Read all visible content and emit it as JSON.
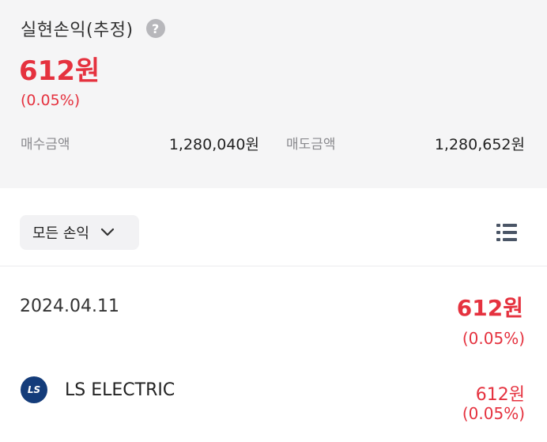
{
  "summary": {
    "title": "실현손익(추정)",
    "help_icon": "?",
    "total_amount": "612원",
    "total_rate": "(0.05%)",
    "buy_label": "매수금액",
    "buy_value": "1,280,040원",
    "sell_label": "매도금액",
    "sell_value": "1,280,652원"
  },
  "filter": {
    "label": "모든 손익",
    "icon": "chevron-down-icon"
  },
  "view_toggle": {
    "icon": "list-icon"
  },
  "entries": [
    {
      "date": "2024.04.11",
      "amount": "612원",
      "rate": "(0.05%)",
      "stocks": [
        {
          "logo_text": "LS",
          "name": "LS ELECTRIC",
          "amount": "612원",
          "rate": "(0.05%)"
        }
      ]
    }
  ],
  "colors": {
    "profit": "#e5323f",
    "summary_bg": "#f5f5f6",
    "logo_bg": "#143c7a"
  }
}
